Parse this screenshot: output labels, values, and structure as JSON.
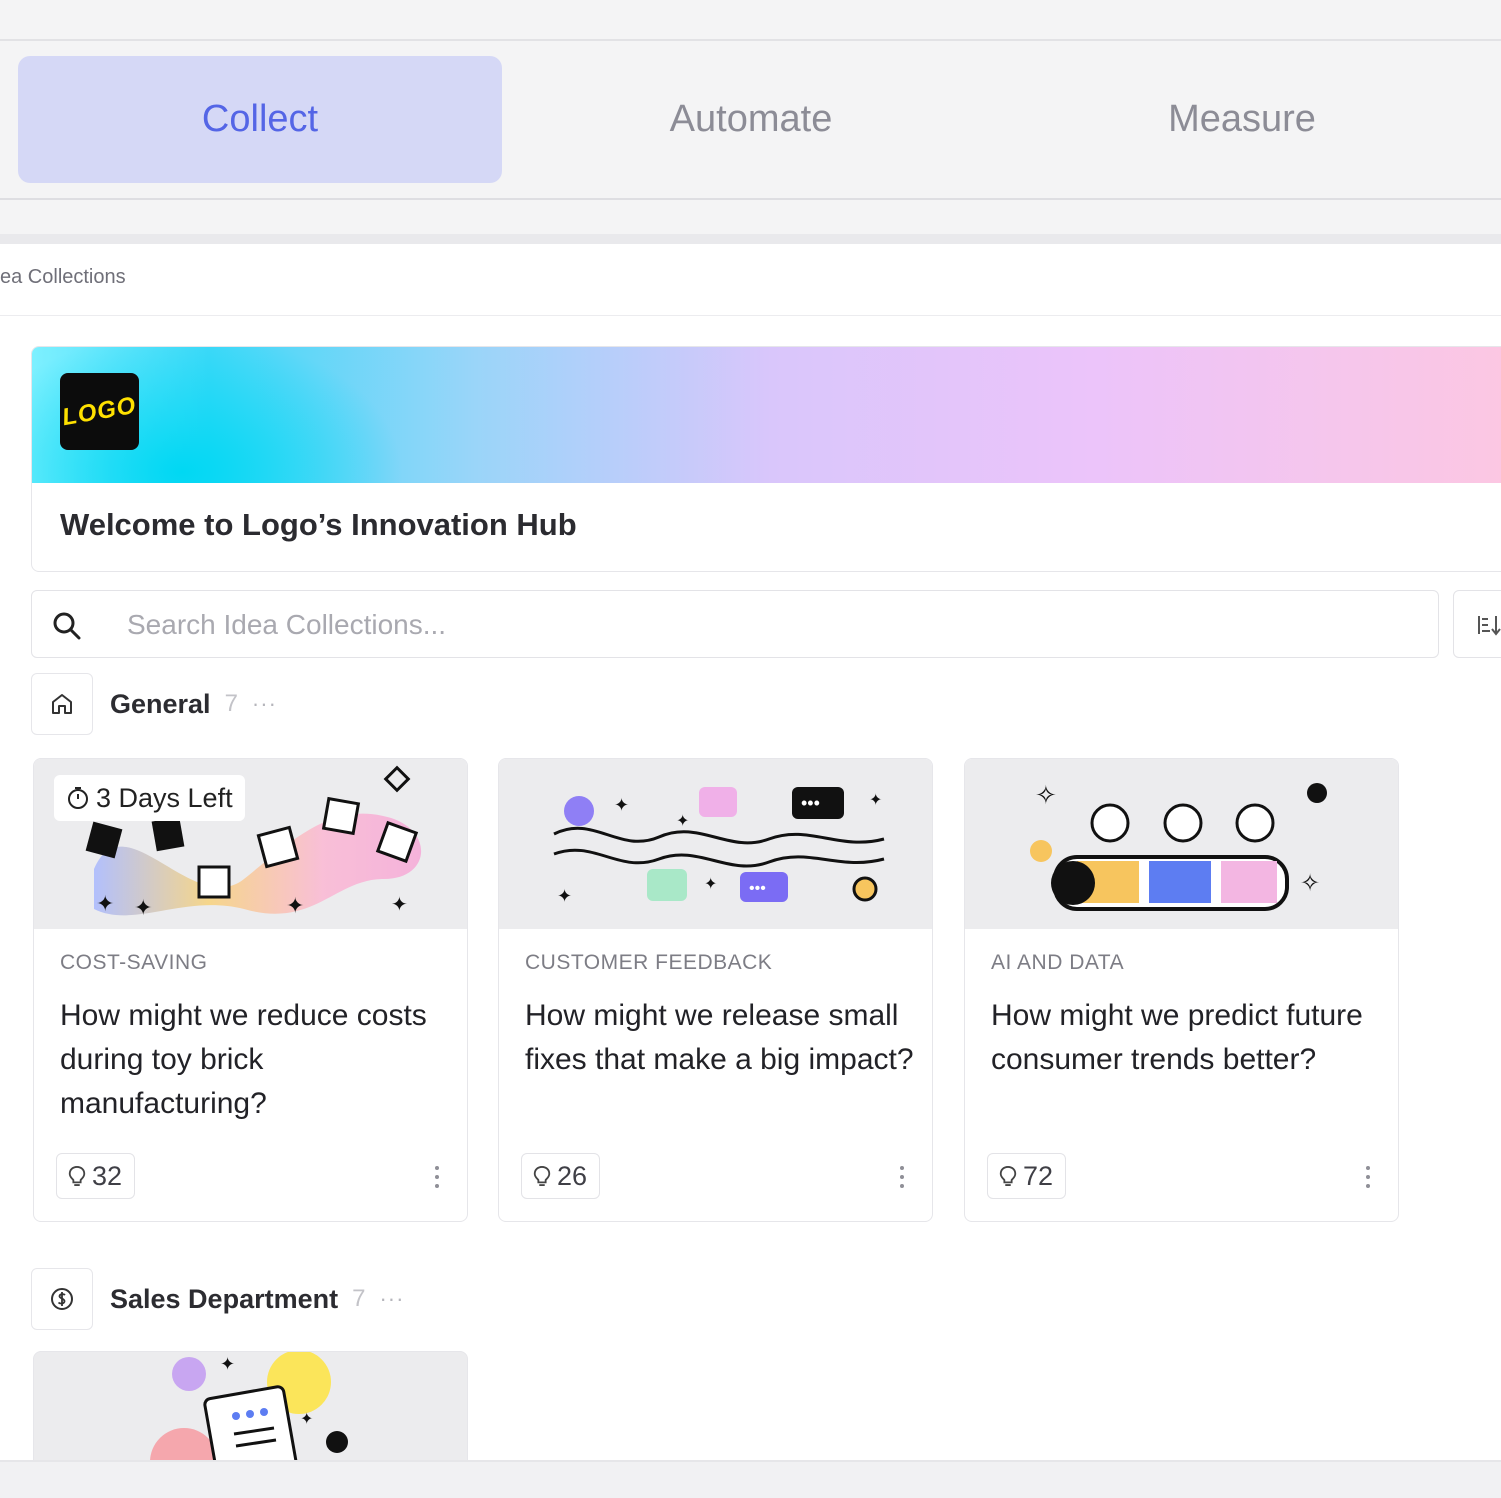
{
  "tabs": [
    {
      "label": "Collect",
      "active": true
    },
    {
      "label": "Automate",
      "active": false
    },
    {
      "label": "Measure",
      "active": false
    }
  ],
  "breadcrumb": "ea Collections",
  "hero": {
    "logo_text": "LOGO",
    "title": "Welcome to Logo’s Innovation Hub"
  },
  "search": {
    "placeholder": "Search Idea Collections..."
  },
  "groups": [
    {
      "name": "General",
      "count": "7",
      "more": "···",
      "icon": "home-icon"
    },
    {
      "name": "Sales Department",
      "count": "7",
      "more": "···",
      "icon": "dollar-icon"
    }
  ],
  "cards": [
    {
      "deadline": "3 Days Left",
      "category": "COST-SAVING",
      "title": "How might we reduce costs during toy brick manufacturing?",
      "ideas": "32"
    },
    {
      "category": "CUSTOMER FEEDBACK",
      "title": "How might we release small fixes that make a big impact?",
      "ideas": "26"
    },
    {
      "category": "AI AND DATA",
      "title": "How might we predict future consumer trends better?",
      "ideas": "72"
    }
  ],
  "colors": {
    "accent": "#5465e6",
    "active_tab_bg": "#d5d8f6"
  }
}
